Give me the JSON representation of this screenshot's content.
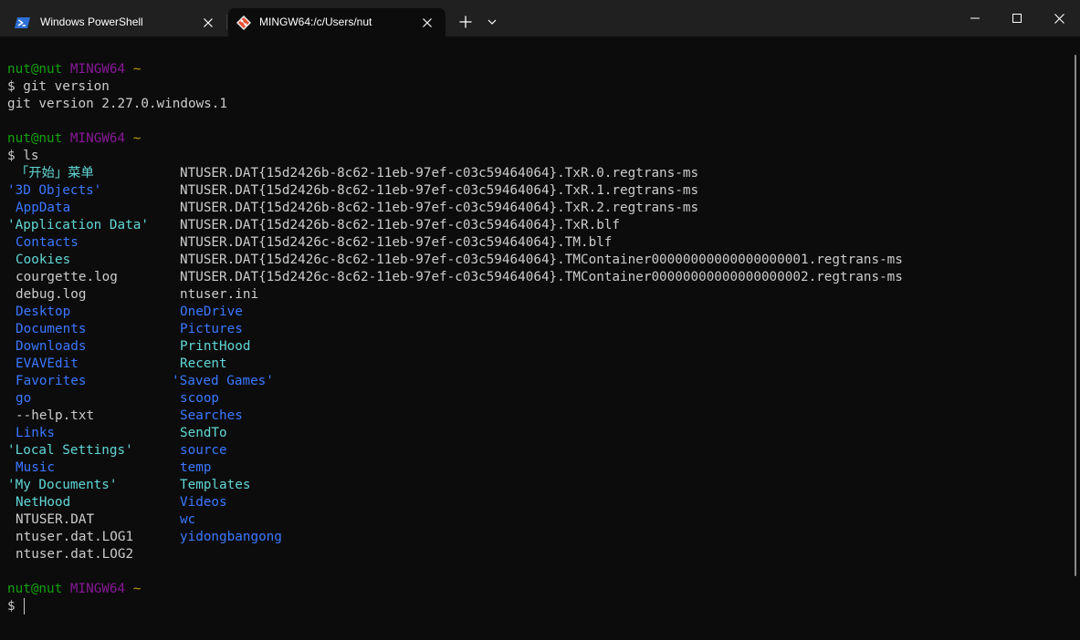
{
  "tabs": [
    {
      "title": "Windows PowerShell",
      "icon": "powershell-icon",
      "active": false
    },
    {
      "title": "MINGW64:/c/Users/nut",
      "icon": "git-icon",
      "active": true
    }
  ],
  "prompt": {
    "user": "nut@nut",
    "host": "MINGW64",
    "path": "~",
    "symbol": "$"
  },
  "commands": [
    {
      "input": "git version",
      "output": "git version 2.27.0.windows.1"
    },
    {
      "input": "ls"
    }
  ],
  "ls_col1": [
    {
      "text": "「开始」菜单",
      "type": "dir-cjk"
    },
    {
      "text": "'3D Objects'",
      "type": "dir"
    },
    {
      "text": "AppData",
      "type": "dir"
    },
    {
      "text": "'Application Data'",
      "type": "link"
    },
    {
      "text": "Contacts",
      "type": "dir"
    },
    {
      "text": "Cookies",
      "type": "link"
    },
    {
      "text": "courgette.log",
      "type": "file"
    },
    {
      "text": "debug.log",
      "type": "file"
    },
    {
      "text": "Desktop",
      "type": "dir"
    },
    {
      "text": "Documents",
      "type": "dir"
    },
    {
      "text": "Downloads",
      "type": "dir"
    },
    {
      "text": "EVAVEdit",
      "type": "dir"
    },
    {
      "text": "Favorites",
      "type": "dir"
    },
    {
      "text": "go",
      "type": "dir"
    },
    {
      "text": "--help.txt",
      "type": "file"
    },
    {
      "text": "Links",
      "type": "dir"
    },
    {
      "text": "'Local Settings'",
      "type": "link"
    },
    {
      "text": "Music",
      "type": "dir"
    },
    {
      "text": "'My Documents'",
      "type": "link"
    },
    {
      "text": "NetHood",
      "type": "link"
    },
    {
      "text": "NTUSER.DAT",
      "type": "file"
    },
    {
      "text": "ntuser.dat.LOG1",
      "type": "file"
    },
    {
      "text": "ntuser.dat.LOG2",
      "type": "file"
    }
  ],
  "ls_col2": [
    {
      "text": "NTUSER.DAT{15d2426b-8c62-11eb-97ef-c03c59464064}.TxR.0.regtrans-ms",
      "type": "file"
    },
    {
      "text": "NTUSER.DAT{15d2426b-8c62-11eb-97ef-c03c59464064}.TxR.1.regtrans-ms",
      "type": "file"
    },
    {
      "text": "NTUSER.DAT{15d2426b-8c62-11eb-97ef-c03c59464064}.TxR.2.regtrans-ms",
      "type": "file"
    },
    {
      "text": "NTUSER.DAT{15d2426b-8c62-11eb-97ef-c03c59464064}.TxR.blf",
      "type": "file"
    },
    {
      "text": "NTUSER.DAT{15d2426c-8c62-11eb-97ef-c03c59464064}.TM.blf",
      "type": "file"
    },
    {
      "text": "NTUSER.DAT{15d2426c-8c62-11eb-97ef-c03c59464064}.TMContainer00000000000000000001.regtrans-ms",
      "type": "file"
    },
    {
      "text": "NTUSER.DAT{15d2426c-8c62-11eb-97ef-c03c59464064}.TMContainer00000000000000000002.regtrans-ms",
      "type": "file"
    },
    {
      "text": "ntuser.ini",
      "type": "file"
    },
    {
      "text": "OneDrive",
      "type": "dir"
    },
    {
      "text": "Pictures",
      "type": "dir"
    },
    {
      "text": "PrintHood",
      "type": "link"
    },
    {
      "text": "Recent",
      "type": "link"
    },
    {
      "text": "'Saved Games'",
      "type": "dir"
    },
    {
      "text": "scoop",
      "type": "dir"
    },
    {
      "text": "Searches",
      "type": "dir"
    },
    {
      "text": "SendTo",
      "type": "link"
    },
    {
      "text": "source",
      "type": "dir"
    },
    {
      "text": "temp",
      "type": "dir"
    },
    {
      "text": "Templates",
      "type": "link"
    },
    {
      "text": "Videos",
      "type": "dir"
    },
    {
      "text": "wc",
      "type": "dir"
    },
    {
      "text": "yidongbangong",
      "type": "dir"
    }
  ],
  "colors": {
    "user": "#13a10e",
    "host": "#881798",
    "path": "#c19c00",
    "text": "#cccccc",
    "dir": "#3b78ff",
    "link": "#61d6d6",
    "background": "#0c0c0c",
    "titlebar": "#202020"
  }
}
